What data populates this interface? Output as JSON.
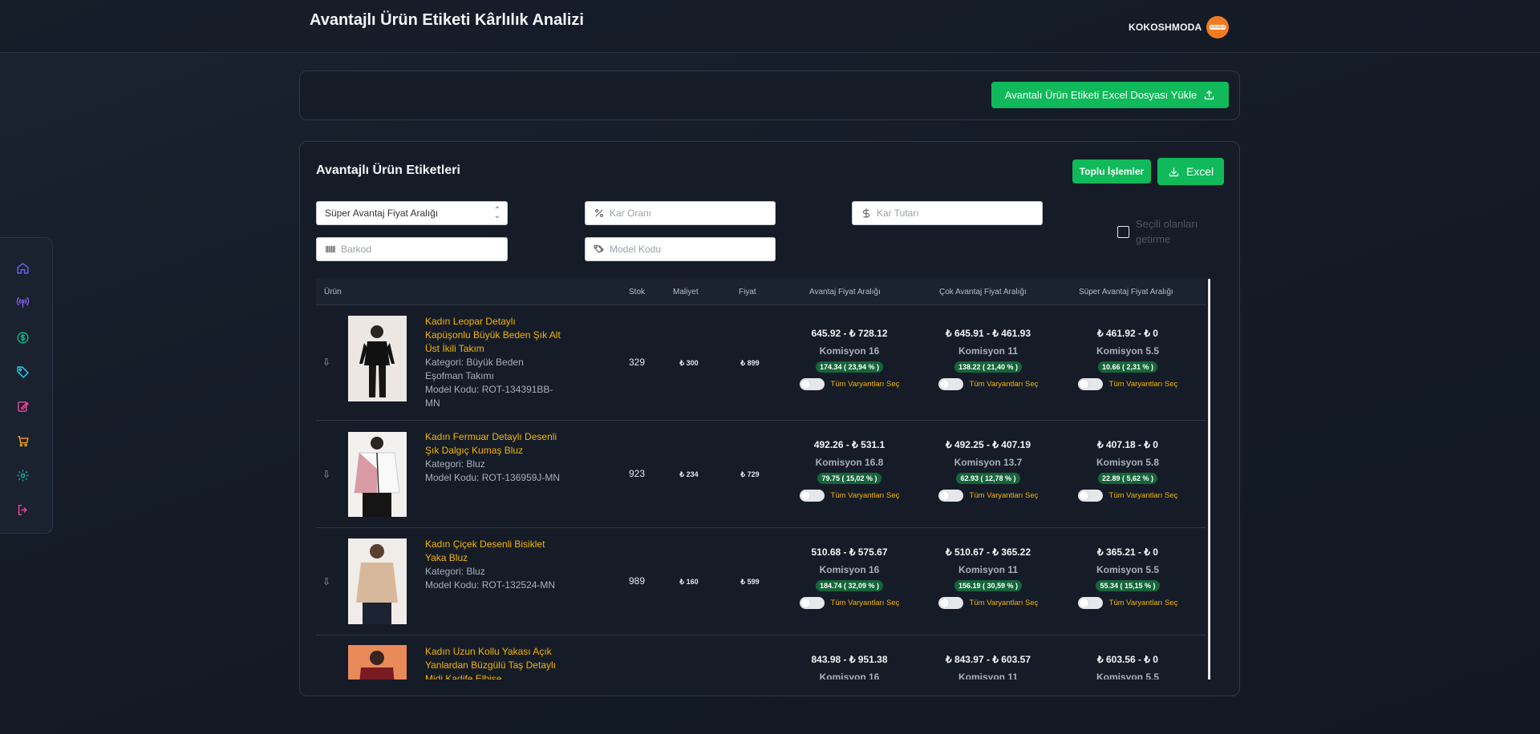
{
  "header": {
    "title": "Avantajlı Ürün Etiketi Kârlılık Analizi",
    "brand": "KOKOSHMODA",
    "brand_logo_text": "trendyol"
  },
  "sidebar": {
    "items": [
      {
        "icon": "home-icon",
        "color": "#6366f1"
      },
      {
        "icon": "broadcast-icon",
        "color": "#8b5cf6"
      },
      {
        "icon": "dollar-icon",
        "color": "#10b981"
      },
      {
        "icon": "tag-icon",
        "color": "#22d3ee"
      },
      {
        "icon": "edit-icon",
        "color": "#ec4899"
      },
      {
        "icon": "cart-icon",
        "color": "#f59e0b"
      },
      {
        "icon": "gear-icon",
        "color": "#14b8a6"
      },
      {
        "icon": "logout-icon",
        "color": "#ec4899"
      }
    ]
  },
  "upload": {
    "label": "Avantalı Ürün Etiketi Excel Dosyası Yükle"
  },
  "section": {
    "title": "Avantajlı Ürün Etiketleri",
    "bulk_label": "Toplu İşlemler",
    "excel_label": "Excel"
  },
  "filters": {
    "range_select": "Süper Avantaj Fiyat Aralığı",
    "profit_rate_placeholder": "Kar Oranı",
    "profit_amount_placeholder": "Kar Tutarı",
    "barcode_placeholder": "Barkod",
    "model_code_placeholder": "Model Kodu",
    "exclude_selected_label": "Seçili olanları getirme"
  },
  "table": {
    "headers": {
      "product": "Ürün",
      "stock": "Stok",
      "cost": "Maliyet",
      "price": "Fiyat",
      "advantage": "Avantaj Fiyat Aralığı",
      "very_advantage": "Çok Avantaj Fiyat Aralığı",
      "super_advantage": "Süper Avantaj Fiyat Aralığı"
    },
    "variant_label": "Tüm Varyantları Seç",
    "rows": [
      {
        "name": "Kadın Leopar Detaylı Kapüşonlu Büyük Beden Şık Alt Üst İkili Takım",
        "category": "Kategori: Büyük Beden Eşofman Takımı",
        "model": "Model Kodu: ROT-134391BB-MN",
        "stock": "329",
        "cost": "₺ 300",
        "price": "₺ 899",
        "adv": {
          "range": "645.92 - ₺ 728.12",
          "comm": "Komisyon 16",
          "profit": "174.34 ( 23,94 % )"
        },
        "very": {
          "range": "₺ 645.91 - ₺ 461.93",
          "comm": "Komisyon 11",
          "profit": "138.22 ( 21,40 % )"
        },
        "super": {
          "range": "₺ 461.92 - ₺ 0",
          "comm": "Komisyon 5.5",
          "profit": "10.66 ( 2,31 % )"
        }
      },
      {
        "name": "Kadın Fermuar Detaylı Desenli Şık Dalgıç Kumaş Bluz",
        "category": "Kategori: Bluz",
        "model": "Model Kodu: ROT-136959J-MN",
        "stock": "923",
        "cost": "₺ 234",
        "price": "₺ 729",
        "adv": {
          "range": "492.26 - ₺ 531.1",
          "comm": "Komisyon 16.8",
          "profit": "79.75 ( 15,02 % )"
        },
        "very": {
          "range": "₺ 492.25 - ₺ 407.19",
          "comm": "Komisyon 13.7",
          "profit": "62.93 ( 12,78 % )"
        },
        "super": {
          "range": "₺ 407.18 - ₺ 0",
          "comm": "Komisyon 5.8",
          "profit": "22.89 ( 5,62 % )"
        }
      },
      {
        "name": "Kadın Çiçek Desenli Bisiklet Yaka Bluz",
        "category": "Kategori: Bluz",
        "model": "Model Kodu: ROT-132524-MN",
        "stock": "989",
        "cost": "₺ 160",
        "price": "₺ 599",
        "adv": {
          "range": "510.68 - ₺ 575.67",
          "comm": "Komisyon 16",
          "profit": "184.74 ( 32,09 % )"
        },
        "very": {
          "range": "₺ 510.67 - ₺ 365.22",
          "comm": "Komisyon 11",
          "profit": "156.19 ( 30,59 % )"
        },
        "super": {
          "range": "₺ 365.21 - ₺ 0",
          "comm": "Komisyon 5.5",
          "profit": "55.34 ( 15,15 % )"
        }
      },
      {
        "name": "Kadın Uzun Kollu Yakası Açık Yanlardan Büzgülü Taş Detaylı Midi Kadife Elbise",
        "category": "",
        "model": "",
        "stock": "",
        "cost": "",
        "price": "",
        "adv": {
          "range": "843.98 - ₺ 951.38",
          "comm": "Komisyon 16",
          "profit": ""
        },
        "very": {
          "range": "₺ 843.97 - ₺ 603.57",
          "comm": "Komisyon 11",
          "profit": ""
        },
        "super": {
          "range": "₺ 603.56 - ₺ 0",
          "comm": "Komisyon 5.5",
          "profit": ""
        }
      }
    ]
  }
}
